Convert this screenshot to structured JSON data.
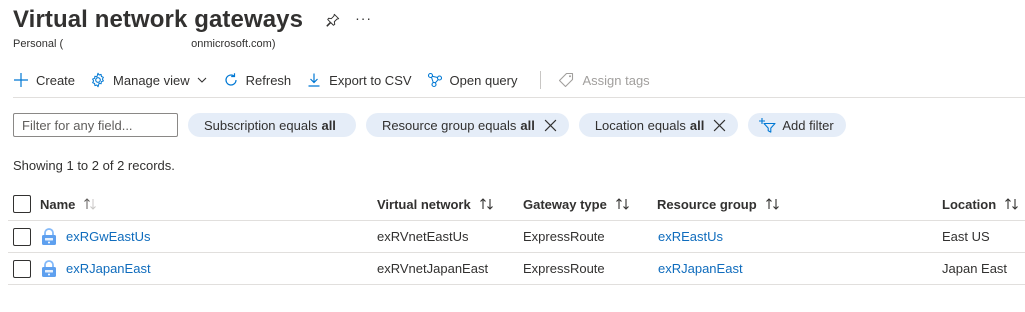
{
  "header": {
    "title": "Virtual network gateways",
    "subtitle_prefix": "Personal (",
    "subtitle_suffix": "onmicrosoft.com)"
  },
  "toolbar": {
    "create": "Create",
    "manage_view": "Manage view",
    "refresh": "Refresh",
    "export_csv": "Export to CSV",
    "open_query": "Open query",
    "assign_tags": "Assign tags"
  },
  "filters": {
    "placeholder": "Filter for any field...",
    "pills": [
      {
        "label": "Subscription equals",
        "value": "all"
      },
      {
        "label": "Resource group equals",
        "value": "all"
      },
      {
        "label": "Location equals",
        "value": "all"
      }
    ],
    "add_filter": "Add filter"
  },
  "records_text": "Showing 1 to 2 of 2 records.",
  "table": {
    "columns": [
      "Name",
      "Virtual network",
      "Gateway type",
      "Resource group",
      "Location"
    ],
    "rows": [
      {
        "name": "exRGwEastUs",
        "vnet": "exRVnetEastUs",
        "type": "ExpressRoute",
        "rg": "exREastUs",
        "location": "East US"
      },
      {
        "name": "exRJapanEast",
        "vnet": "exRVnetJapanEast",
        "type": "ExpressRoute",
        "rg": "exRJapanEast",
        "location": "Japan East"
      }
    ]
  },
  "colors": {
    "link": "#0f6cbd",
    "accent": "#0078d4",
    "pill_bg": "#e5edf8"
  }
}
